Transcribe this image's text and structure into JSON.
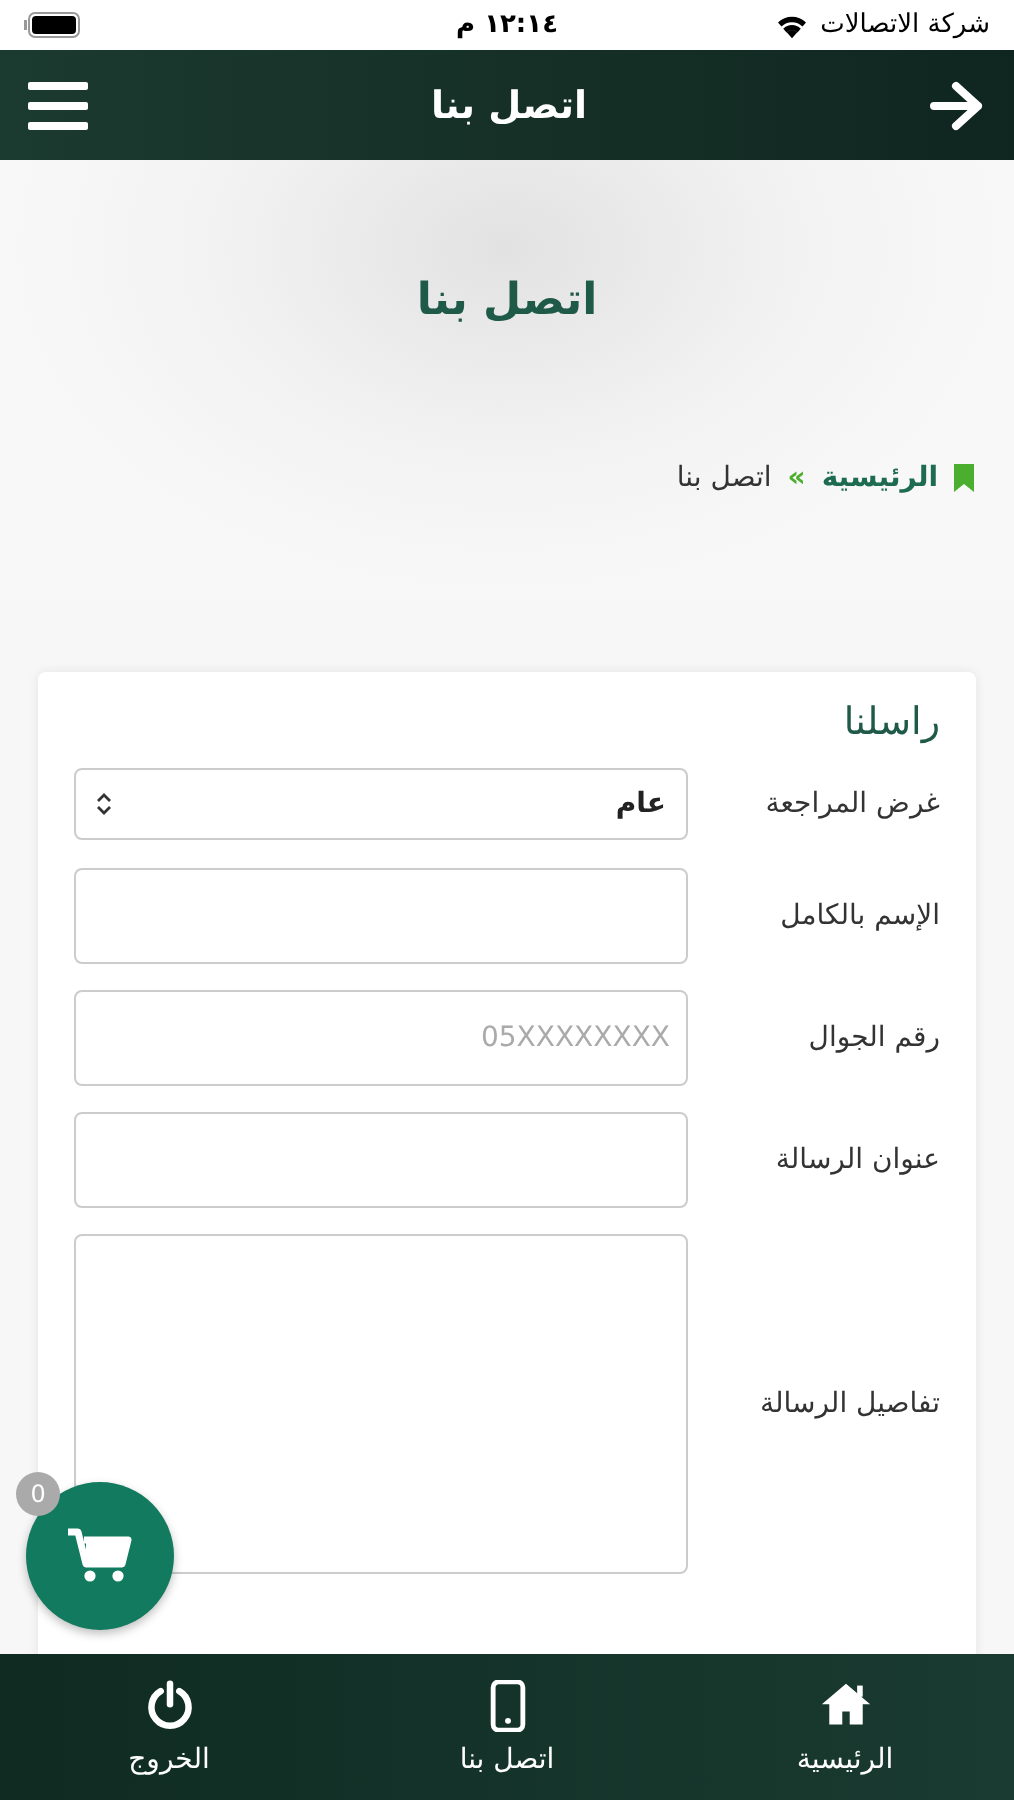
{
  "status_bar": {
    "carrier": "شركة الاتصالات",
    "time": "١٢:١٤ م"
  },
  "header": {
    "title": "اتصل بنا"
  },
  "hero": {
    "title": "اتصل بنا"
  },
  "breadcrumb": [
    {
      "label": "الرئيسية",
      "kind": "link"
    },
    {
      "label": "اتصل بنا",
      "kind": "current"
    }
  ],
  "breadcrumb_separator": "»",
  "form": {
    "title": "راسلنا",
    "fields": [
      {
        "label": "غرض المراجعة",
        "kind": "select",
        "value": "عام"
      },
      {
        "label": "الإسم بالكامل",
        "kind": "text"
      },
      {
        "label": "رقم الجوال",
        "kind": "text",
        "placeholder": "05XXXXXXXX"
      },
      {
        "label": "عنوان الرسالة",
        "kind": "text"
      },
      {
        "label": "تفاصيل الرسالة",
        "kind": "textarea"
      }
    ]
  },
  "cart": {
    "count": "0"
  },
  "bottom_nav": [
    {
      "label": "الرئيسية",
      "kind": "home"
    },
    {
      "label": "اتصل بنا",
      "kind": "phone"
    },
    {
      "label": "الخروج",
      "kind": "power"
    }
  ]
}
